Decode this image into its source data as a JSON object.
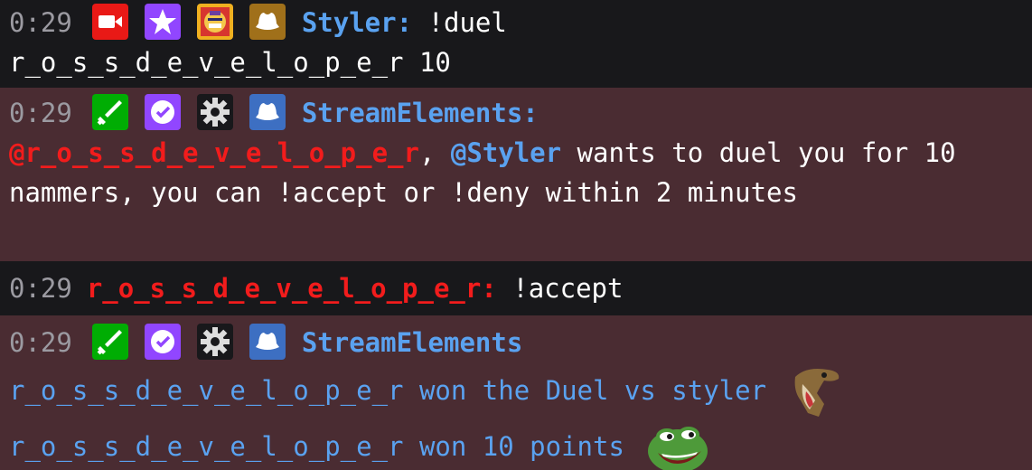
{
  "messages": [
    {
      "timestamp": "0:29",
      "badges": [
        "video-camera-badge",
        "star-badge",
        "robot-face-badge",
        "cowboy-hat-badge"
      ],
      "username": "Styler:",
      "text_line1": " !duel",
      "text_line2": "r_o_s_s_d_e_v_e_l_o_p_e_r 10",
      "name_color": "#5aa2f0"
    },
    {
      "timestamp": "0:29",
      "badges": [
        "sword-badge",
        "verified-check-badge",
        "gear-badge",
        "cowboy-hat-badge"
      ],
      "username": "StreamElements:",
      "mention1": "@r_o_s_s_d_e_v_e_l_o_p_e_r",
      "comma": ", ",
      "mention2": "@Styler",
      "text": " wants to duel you for 10 nammers, you can !accept or !deny within 2 minutes",
      "name_color": "#5aa2f0",
      "highlight_color": "#4a2c32"
    },
    {
      "timestamp": "0:29",
      "username": "r_o_s_s_d_e_v_e_l_o_p_e_r:",
      "text": " !accept",
      "name_color": "#f21c1c"
    },
    {
      "timestamp": "0:29",
      "badges": [
        "sword-badge",
        "verified-check-badge",
        "gear-badge",
        "cowboy-hat-badge"
      ],
      "username": "StreamElements",
      "line1": "r_o_s_s_d_e_v_e_l_o_p_e_r won the Duel vs styler",
      "emote1": "raptor-emote",
      "line2": "r_o_s_s_d_e_v_e_l_o_p_e_r won 10 points",
      "emote2": "pepe-emote",
      "name_color": "#5aa2f0"
    }
  ]
}
